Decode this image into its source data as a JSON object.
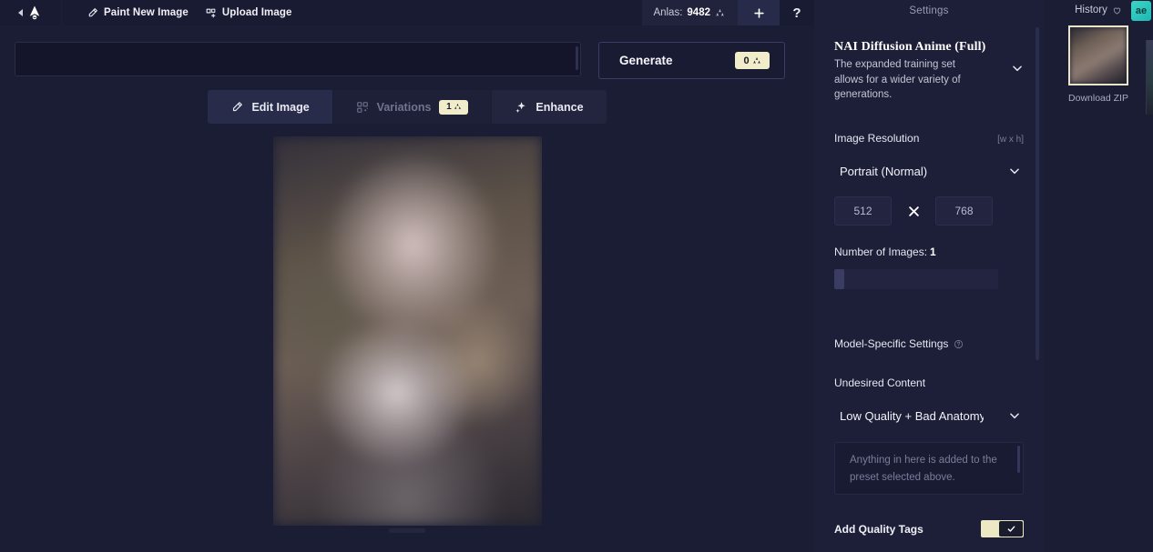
{
  "topbar": {
    "collapse_icon": "chevron-left-icon",
    "logo_icon": "novelai-logo-icon",
    "paint_new_image": "Paint New Image",
    "paint_icon": "pencil-icon",
    "upload_image": "Upload Image",
    "upload_icon": "upload-icon",
    "anlas_label": "Anlas:",
    "anlas_count": "9482",
    "anlas_icon": "anlas-icon",
    "plus_icon": "plus-icon",
    "help_label": "?"
  },
  "prompt": {
    "value": "",
    "placeholder": ""
  },
  "generate": {
    "label": "Generate",
    "cost": "0",
    "cost_icon": "anlas-icon"
  },
  "tabs": [
    {
      "label": "Edit Image",
      "icon": "pencil-icon",
      "state": "active",
      "badge": ""
    },
    {
      "label": "Variations",
      "icon": "grid-variations-icon",
      "state": "disabled",
      "badge": "1"
    },
    {
      "label": "Enhance",
      "icon": "sparkles-icon",
      "state": "normal",
      "badge": ""
    }
  ],
  "settings": {
    "title": "Settings",
    "model": {
      "name": "NAI Diffusion Anime (Full)",
      "description": "The expanded training set allows for a wider variety of generations.",
      "chevron_icon": "chevron-down-icon"
    },
    "resolution": {
      "label": "Image Resolution",
      "hint": "[w x h]",
      "preset": "Portrait (Normal)",
      "chevron_icon": "chevron-down-icon",
      "width": "512",
      "height": "768",
      "x_icon": "close-x-icon"
    },
    "num_images": {
      "label": "Number of Images:",
      "value": "1"
    },
    "model_specific": {
      "label": "Model-Specific Settings",
      "help_icon": "question-circle-icon"
    },
    "undesired_content": {
      "label": "Undesired Content",
      "preset": "Low Quality + Bad Anatomy",
      "chevron_icon": "chevron-down-icon",
      "textarea_value": "",
      "textarea_placeholder": "Anything in here is added to the preset selected above."
    },
    "quality_tags": {
      "label": "Add Quality Tags",
      "enabled": true,
      "check_icon": "check-icon"
    }
  },
  "history": {
    "title": "History",
    "heart_icon": "heart-icon",
    "badge_label": "ae",
    "download_zip": "Download ZIP"
  },
  "colors": {
    "app_bg": "#1b1d35",
    "panel_bg": "#1d1f38",
    "topbar_bg": "#191b32",
    "accent_cream": "#f1edcb",
    "accent_teal": "#3bd6c6",
    "text_primary": "#e8e8f0",
    "text_muted": "#9a9cb4"
  }
}
